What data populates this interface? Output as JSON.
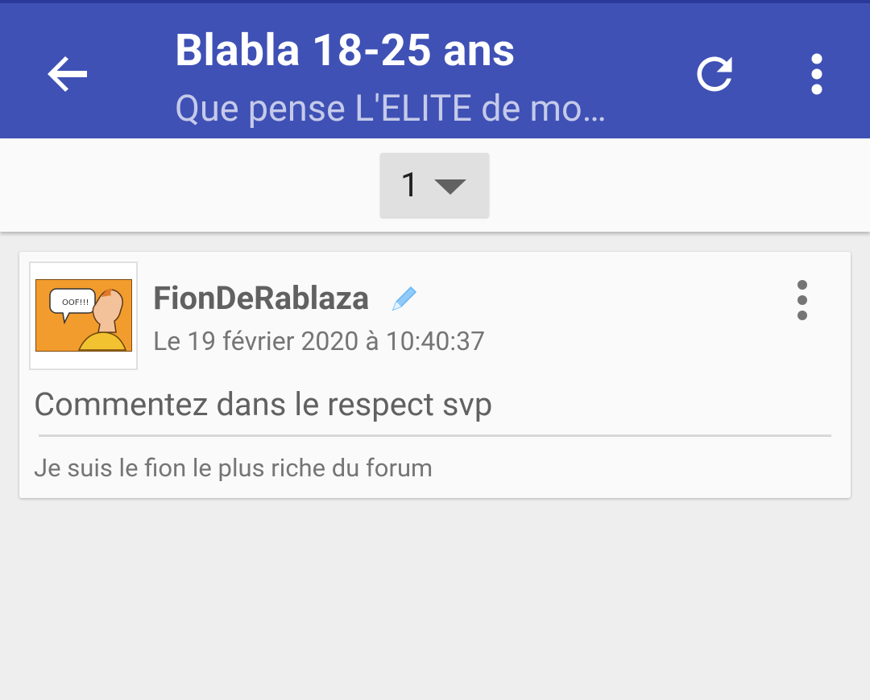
{
  "appbar": {
    "title": "Blabla 18-25 ans",
    "subtitle": "Que pense L'ELITE de mo…",
    "back_icon": "arrow-back-icon",
    "refresh_icon": "refresh-icon",
    "more_icon": "more-vert-icon",
    "color": "#3f51b5"
  },
  "pager": {
    "current_page": "1",
    "dropdown_icon": "caret-down-icon"
  },
  "post": {
    "author": "FionDeRablaza",
    "edit_icon": "pencil-icon",
    "date": "Le 19 février 2020 à 10:40:37",
    "body": "Commentez dans le respect svp",
    "signature": "Je suis le fion le plus riche du forum",
    "menu_icon": "more-vert-icon",
    "avatar_speech_text": "OOF!!!"
  }
}
